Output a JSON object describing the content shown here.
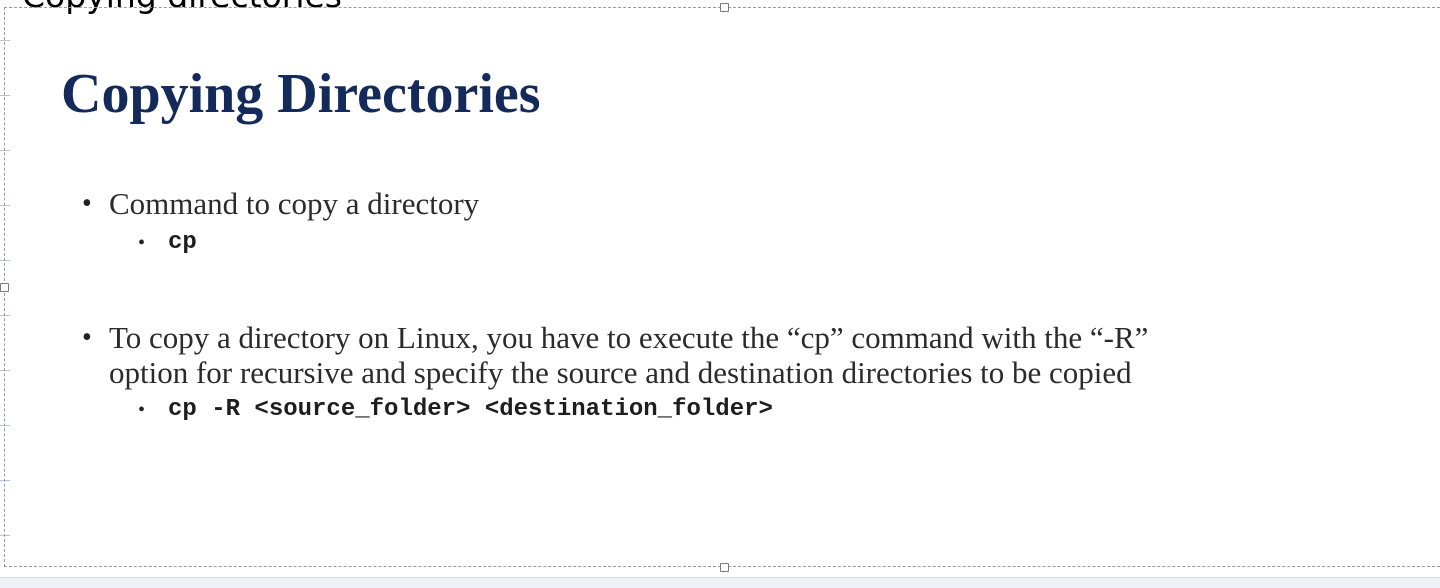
{
  "editor": {
    "overflow_title": "Copying directories"
  },
  "slide": {
    "title": "Copying Directories",
    "bullets": [
      {
        "text": "Command to copy a directory",
        "sub": [
          "cp"
        ]
      },
      {
        "text_line1": "To copy a directory on Linux, you have to execute the “cp” command with the “-R”",
        "text_line2": "option for recursive and specify the source and destination directories to be copied",
        "sub": [
          "cp -R <source_folder> <destination_folder>"
        ]
      }
    ]
  },
  "colors": {
    "title": "#142a5a",
    "body_text": "#2b2b2b",
    "frame_border": "#9a9a9a"
  }
}
